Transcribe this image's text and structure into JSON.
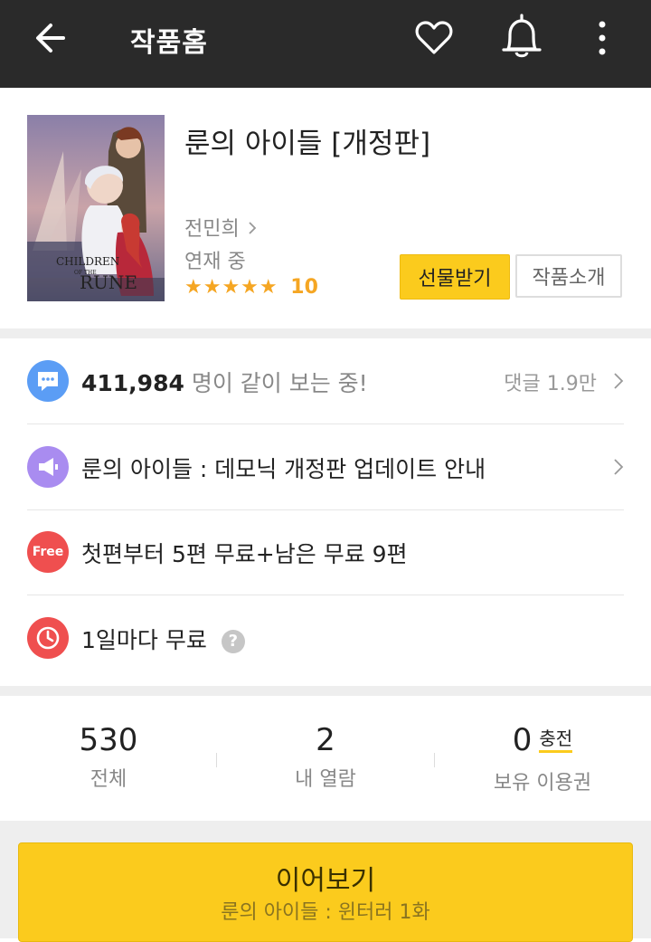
{
  "header": {
    "title": "작품홈",
    "icons": [
      "back-arrow-icon",
      "heart-icon",
      "bell-icon",
      "more-vertical-icon"
    ]
  },
  "work": {
    "title": "룬의 아이들 [개정판]",
    "author": "전민희",
    "status": "연재 중",
    "stars": "★★★★★",
    "rating": "10",
    "gift_button": "선물받기",
    "intro_button": "작품소개",
    "cover_logo": "CHILDREN OF THE RUNE"
  },
  "rows": {
    "viewers": {
      "count": "411,984",
      "text": " 명이 같이 보는 중!",
      "comments": "댓글 1.9만"
    },
    "notice": {
      "text": "룬의 아이들 : 데모닉 개정판 업데이트 안내"
    },
    "free": {
      "badge": "Free",
      "text": "첫편부터 5편 무료+남은 무료 9편"
    },
    "daily": {
      "text": "1일마다 무료",
      "help": "?"
    }
  },
  "stats": {
    "total": {
      "value": "530",
      "label": "전체"
    },
    "mine": {
      "value": "2",
      "label": "내 열람"
    },
    "tickets": {
      "value": "0",
      "label": "보유 이용권",
      "charge": "충전"
    }
  },
  "continue": {
    "label": "이어보기",
    "episode": "룬의 아이들 : 윈터러 1화"
  },
  "colors": {
    "accent": "#fbcb1d",
    "topbar": "#2a2a2a",
    "star": "#f5a623",
    "chat": "#5b9df5",
    "notice": "#a98cf0",
    "free": "#ef4f4f",
    "clock": "#ef4f4f"
  }
}
